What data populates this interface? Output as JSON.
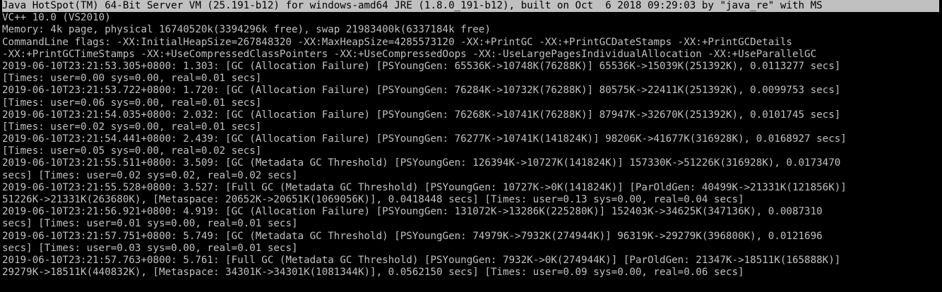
{
  "terminal": {
    "lines": [
      "Java HotSpot(TM) 64-Bit Server VM (25.191-b12) for windows-amd64 JRE (1.8.0_191-b12), built on Oct  6 2018 09:29:03 by \"java_re\" with MS",
      "VC++ 10.0 (VS2010)",
      "Memory: 4k page, physical 16740520k(3394296k free), swap 21983400k(6337184k free)",
      "CommandLine flags: -XX:InitialHeapSize=267848320 -XX:MaxHeapSize=4285573120 -XX:+PrintGC -XX:+PrintGCDateStamps -XX:+PrintGCDetails",
      "-XX:+PrintGCTimeStamps -XX:+UseCompressedClassPointers -XX:+UseCompressedOops -XX:-UseLargePagesIndividualAllocation -XX:+UseParallelGC",
      "2019-06-10T23:21:53.305+0800: 1.303: [GC (Allocation Failure) [PSYoungGen: 65536K->10748K(76288K)] 65536K->15039K(251392K), 0.0113277 secs]",
      "[Times: user=0.00 sys=0.00, real=0.01 secs]",
      "2019-06-10T23:21:53.722+0800: 1.720: [GC (Allocation Failure) [PSYoungGen: 76284K->10732K(76288K)] 80575K->22411K(251392K), 0.0099753 secs]",
      "[Times: user=0.06 sys=0.00, real=0.01 secs]",
      "2019-06-10T23:21:54.035+0800: 2.032: [GC (Allocation Failure) [PSYoungGen: 76268K->10741K(76288K)] 87947K->32670K(251392K), 0.0101745 secs]",
      "[Times: user=0.02 sys=0.00, real=0.01 secs]",
      "2019-06-10T23:21:54.441+0800: 2.439: [GC (Allocation Failure) [PSYoungGen: 76277K->10741K(141824K)] 98206K->41677K(316928K), 0.0168927 secs]",
      "[Times: user=0.05 sys=0.00, real=0.02 secs]",
      "2019-06-10T23:21:55.511+0800: 3.509: [GC (Metadata GC Threshold) [PSYoungGen: 126394K->10727K(141824K)] 157330K->51226K(316928K), 0.0173470",
      "secs] [Times: user=0.02 sys=0.02, real=0.02 secs]",
      "2019-06-10T23:21:55.528+0800: 3.527: [Full GC (Metadata GC Threshold) [PSYoungGen: 10727K->0K(141824K)] [ParOldGen: 40499K->21331K(121856K)]",
      "51226K->21331K(263680K), [Metaspace: 20652K->20651K(1069056K)], 0.0418448 secs] [Times: user=0.13 sys=0.00, real=0.04 secs]",
      "2019-06-10T23:21:56.921+0800: 4.919: [GC (Allocation Failure) [PSYoungGen: 131072K->13286K(225280K)] 152403K->34625K(347136K), 0.0087310",
      "secs] [Times: user=0.01 sys=0.00, real=0.01 secs]",
      "2019-06-10T23:21:57.751+0800: 5.749: [GC (Metadata GC Threshold) [PSYoungGen: 74979K->7932K(274944K)] 96319K->29279K(396800K), 0.0121696",
      "secs] [Times: user=0.03 sys=0.00, real=0.01 secs]",
      "2019-06-10T23:21:57.763+0800: 5.761: [Full GC (Metadata GC Threshold) [PSYoungGen: 7932K->0K(274944K)] [ParOldGen: 21347K->18511K(165888K)]",
      "29279K->18511K(440832K), [Metaspace: 34301K->34301K(1081344K)], 0.0562150 secs] [Times: user=0.09 sys=0.00, real=0.06 secs]"
    ]
  },
  "colors": {
    "background": "#000000",
    "text": "#c0c0c0",
    "selection_bg": "#c0c0c0",
    "selection_text": "#000000"
  }
}
